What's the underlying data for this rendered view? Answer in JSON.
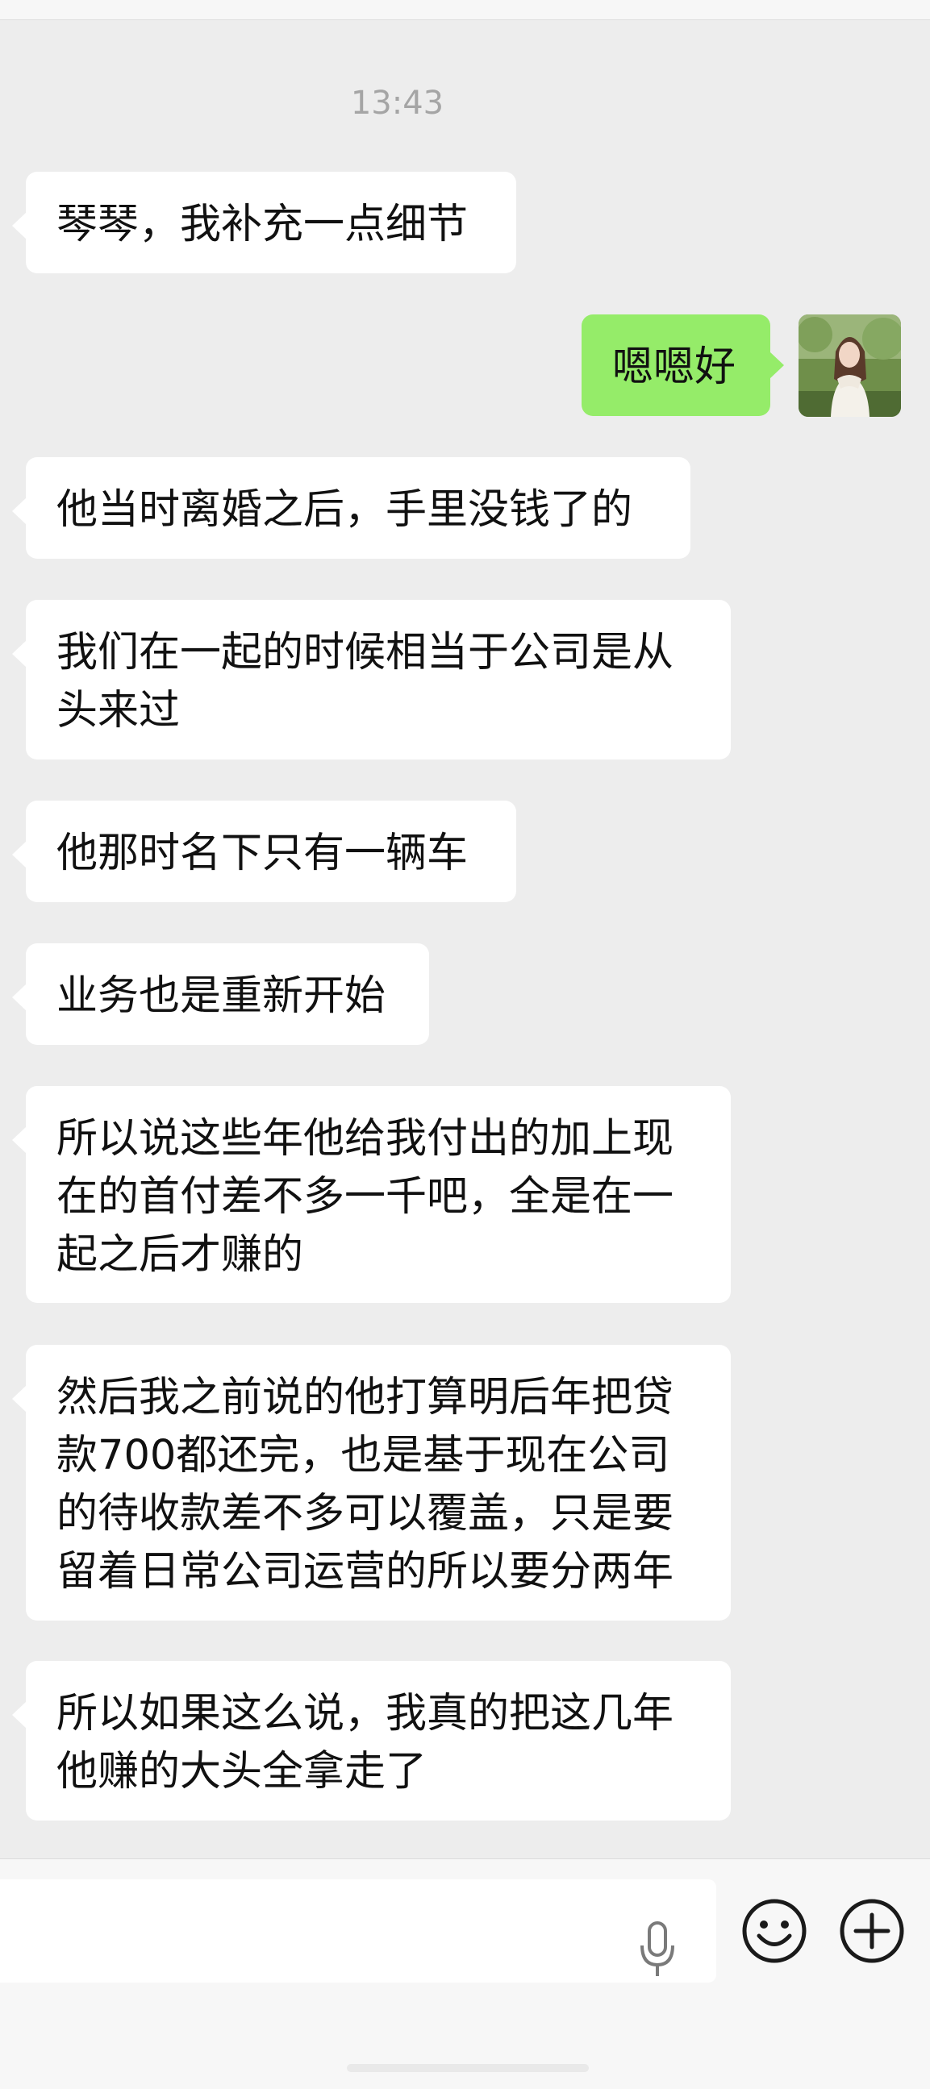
{
  "chat": {
    "timestamp": "13:43",
    "messages": [
      {
        "side": "in",
        "text": "琴琴，我补充一点细节"
      },
      {
        "side": "out",
        "text": "嗯嗯好"
      },
      {
        "side": "in",
        "text": "他当时离婚之后，手里没钱了的"
      },
      {
        "side": "in",
        "text": "我们在一起的时候相当于公司是从\n头来过"
      },
      {
        "side": "in",
        "text": "他那时名下只有一辆车"
      },
      {
        "side": "in",
        "text": "业务也是重新开始"
      },
      {
        "side": "in",
        "text": "所以说这些年他给我付出的加上现\n在的首付差不多一千吧，全是在一\n起之后才赚的"
      },
      {
        "side": "in",
        "text": "然后我之前说的他打算明后年把贷\n款700都还完，也是基于现在公司\n的待收款差不多可以覆盖，只是要\n留着日常公司运营的所以要分两年"
      },
      {
        "side": "in",
        "text": "所以如果这么说，我真的把这几年\n他赚的大头全拿走了"
      }
    ]
  },
  "input_bar": {
    "mic_icon": "microphone-icon",
    "emoji_icon": "smiley-icon",
    "more_icon": "plus-circle-icon"
  },
  "colors": {
    "background": "#ededed",
    "incoming_bubble": "#ffffff",
    "outgoing_bubble": "#95ec69",
    "timestamp_text": "#a5a5a5"
  }
}
